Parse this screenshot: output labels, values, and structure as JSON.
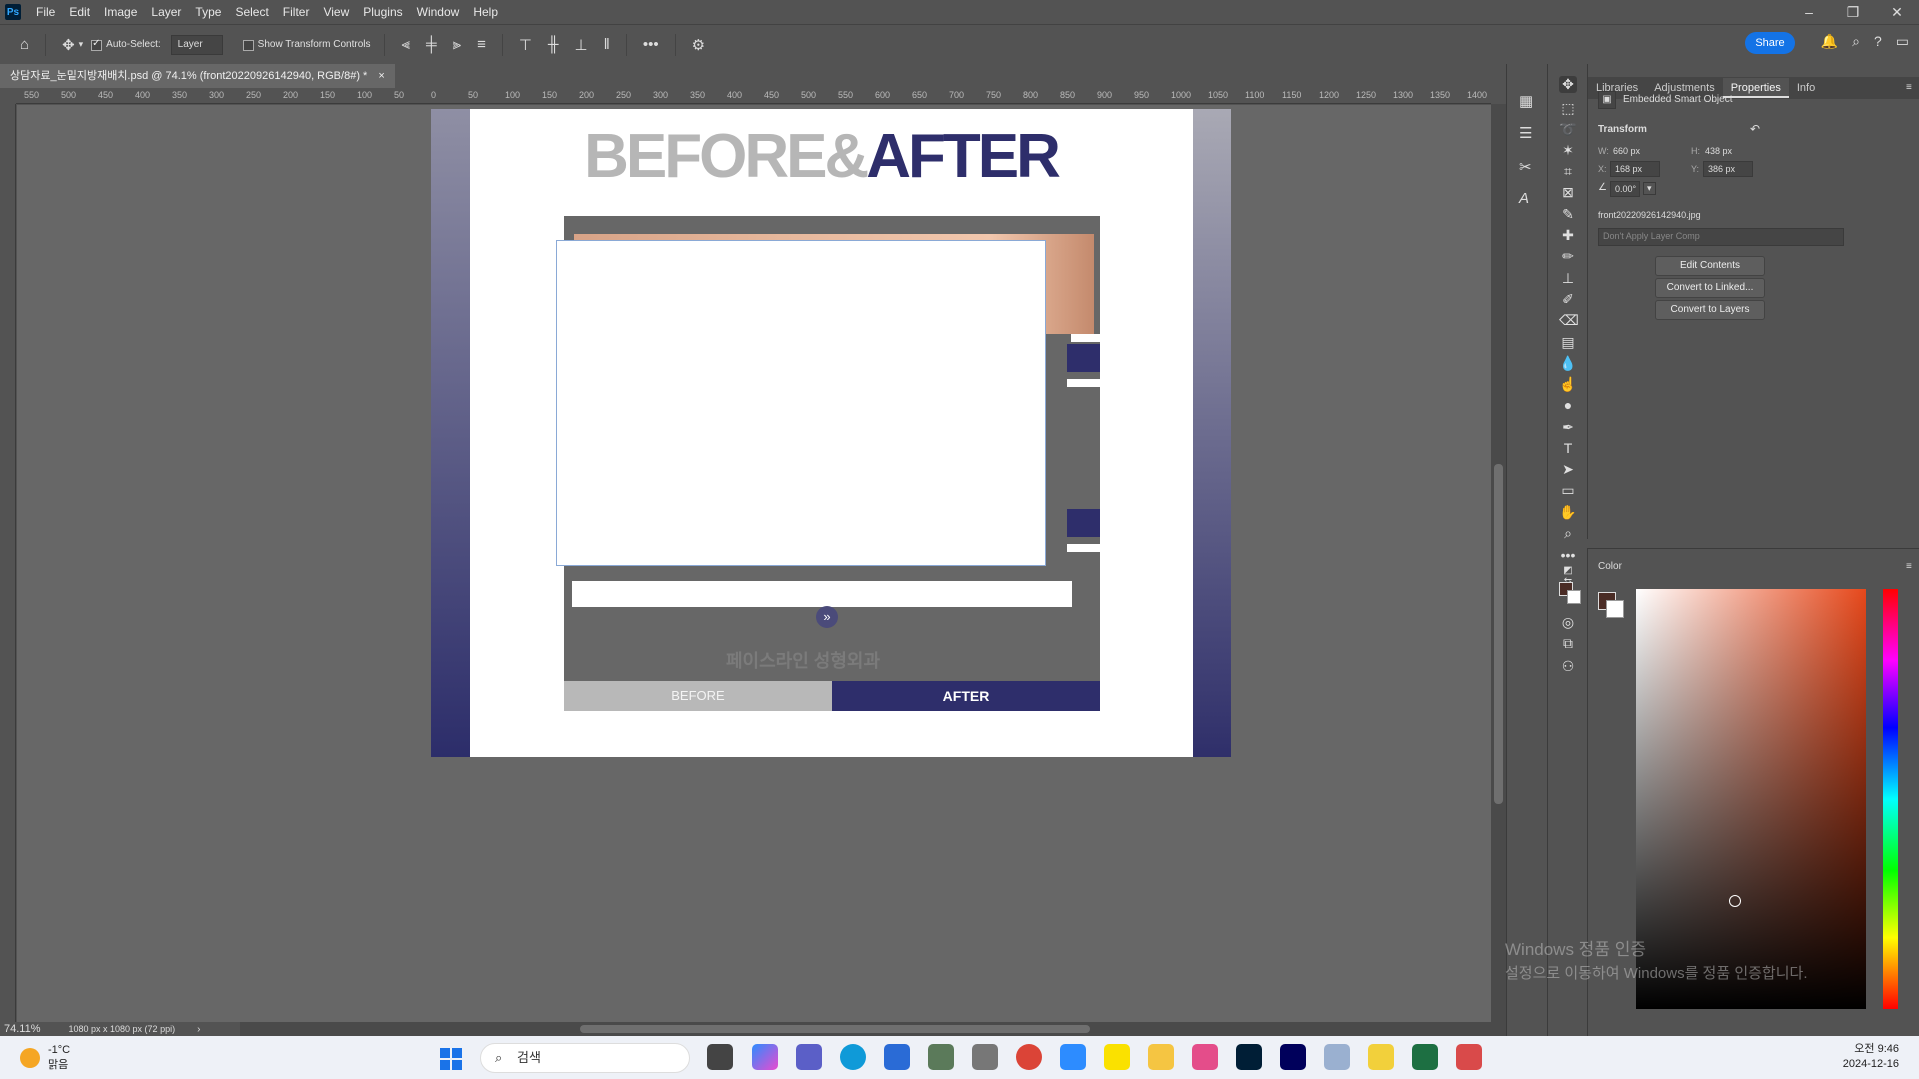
{
  "app": {
    "logo": "Ps"
  },
  "menu": [
    "File",
    "Edit",
    "Image",
    "Layer",
    "Type",
    "Select",
    "Filter",
    "View",
    "Plugins",
    "Window",
    "Help"
  ],
  "window_controls": {
    "minimize": "–",
    "restore": "❐",
    "close": "✕"
  },
  "options_bar": {
    "auto_select_label": "Auto-Select:",
    "auto_select_checked": true,
    "auto_select_value": "Layer",
    "show_transform_label": "Show Transform Controls",
    "share_label": "Share"
  },
  "document_tab": {
    "title": "상담자료_눈밑지방재배치.psd @ 74.1% (front20220926142940, RGB/8#) *"
  },
  "ruler_h_labels": [
    "550",
    "500",
    "450",
    "400",
    "350",
    "300",
    "250",
    "200",
    "150",
    "100",
    "50",
    "0",
    "50",
    "100",
    "150",
    "200",
    "250",
    "300",
    "350",
    "400",
    "450",
    "500",
    "550",
    "600",
    "650",
    "700",
    "750",
    "800",
    "850",
    "900",
    "950",
    "1000",
    "1050",
    "1100",
    "1150",
    "1200",
    "1250",
    "1300",
    "1350",
    "1400"
  ],
  "canvas": {
    "headline_before": "BEFORE&",
    "headline_after": "AFTER",
    "watermark": "페이스라인 성형외과",
    "arrow": "»",
    "btn_before": "BEFORE",
    "btn_after": "AFTER"
  },
  "status": {
    "zoom": "74.11%",
    "dims": "1080 px x 1080 px (72 ppi)"
  },
  "properties": {
    "tabs": [
      "Libraries",
      "Adjustments",
      "Properties",
      "Info"
    ],
    "active_tab": "Properties",
    "object_type": "Embedded Smart Object",
    "transform_label": "Transform",
    "w_label": "W:",
    "w_value": "660 px",
    "h_label": "H:",
    "h_value": "438 px",
    "x_label": "X:",
    "x_value": "168 px",
    "y_label": "Y:",
    "y_value": "386 px",
    "angle": "0.00°",
    "filename": "front20220926142940.jpg",
    "layer_comp": "Don't Apply Layer Comp",
    "btn_edit": "Edit Contents",
    "btn_linked": "Convert to Linked...",
    "btn_layers": "Convert to Layers"
  },
  "color_panel": {
    "title": "Color",
    "fg_color": "#4a2c25",
    "bg_color": "#ffffff"
  },
  "windows_watermark": {
    "line1": "Windows 정품 인증",
    "line2": "설정으로 이동하여 Windows를 정품 인증합니다."
  },
  "taskbar": {
    "weather_temp": "-1°C",
    "weather_desc": "맑음",
    "search_placeholder": "검색",
    "time": "오전 9:46",
    "date": "2024-12-16"
  }
}
